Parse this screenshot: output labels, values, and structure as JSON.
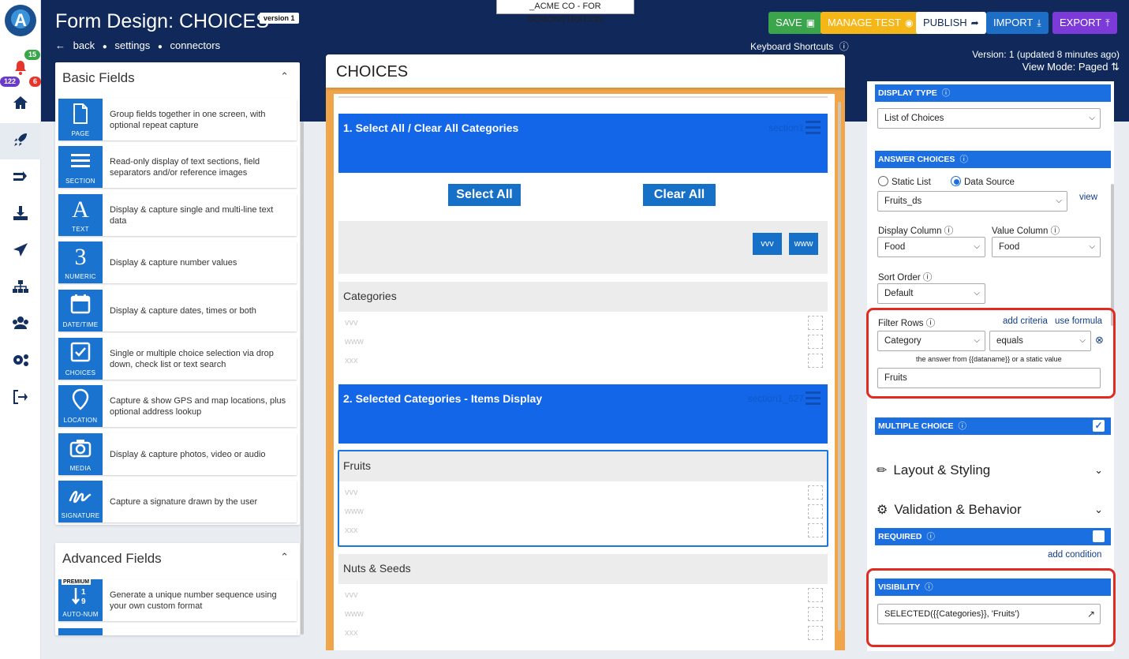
{
  "header": {
    "demo_tag": "_ACME CO - FOR DEMONSTRATION",
    "title": "Form Design: CHOICES",
    "version_badge": "version 1",
    "crumbs": [
      "back",
      "settings",
      "connectors"
    ],
    "keyboard_shortcuts": "Keyboard Shortcuts",
    "version_info": "Version: 1 (updated 8 minutes ago)",
    "view_mode": "View Mode: Paged",
    "buttons": {
      "save": "SAVE",
      "manage_test": "MANAGE TEST",
      "publish": "PUBLISH",
      "import": "IMPORT",
      "export": "EXPORT"
    },
    "button_colors": {
      "save": "#3aa54a",
      "manage_test": "#f5b617",
      "publish": "#ffffff",
      "import": "#1d6ec7",
      "export": "#7c3bd8"
    },
    "header_bg": "#10295a"
  },
  "rail": {
    "badge_green": "15",
    "badge_purple": "122",
    "badge_red": "6",
    "icons": [
      "bell-icon",
      "home-icon",
      "rocket-icon",
      "transfer-icon",
      "download-icon",
      "send-icon",
      "hierarchy-icon",
      "group-icon",
      "settings-icon",
      "logout-icon"
    ]
  },
  "basic_fields": {
    "title": "Basic Fields",
    "items": [
      {
        "label": "PAGE",
        "icon": "page-icon",
        "desc": "Group fields together in one screen, with optional repeat capture"
      },
      {
        "label": "SECTION",
        "icon": "section-icon",
        "desc": "Read-only display of text sections, field separators and/or reference images"
      },
      {
        "label": "TEXT",
        "icon": "text-icon",
        "desc": "Display & capture single and multi-line text data"
      },
      {
        "label": "NUMERIC",
        "icon": "numeric-icon",
        "desc": "Display & capture number values"
      },
      {
        "label": "DATE/TIME",
        "icon": "calendar-icon",
        "desc": "Display & capture dates, times or both"
      },
      {
        "label": "CHOICES",
        "icon": "checkbox-icon",
        "desc": "Single or multiple choice selection via drop down, check list or text search"
      },
      {
        "label": "LOCATION",
        "icon": "location-pin-icon",
        "desc": "Capture & show GPS and map locations, plus optional address lookup"
      },
      {
        "label": "MEDIA",
        "icon": "camera-icon",
        "desc": "Display & capture photos, video or audio"
      },
      {
        "label": "SIGNATURE",
        "icon": "signature-icon",
        "desc": "Capture a signature drawn by the user"
      }
    ]
  },
  "advanced_fields": {
    "title": "Advanced Fields",
    "items": [
      {
        "label": "AUTO-NUM",
        "badge": "PREMIUM",
        "icon": "sort-numeric-icon",
        "desc": "Generate a unique number sequence using your own custom format"
      }
    ]
  },
  "canvas": {
    "title": "CHOICES",
    "section1": {
      "title": "1. Select All / Clear All Categories",
      "id": "section1"
    },
    "select_all": "Select All",
    "clear_all": "Clear All",
    "small_buttons": [
      "vvv",
      "www"
    ],
    "categories": {
      "title": "Categories",
      "options": [
        "vvv",
        "www",
        "xxx"
      ]
    },
    "section2": {
      "title": "2. Selected Categories - Items Display",
      "id": "section1_627"
    },
    "fruits": {
      "title": "Fruits",
      "options": [
        "vvv",
        "www",
        "xxx"
      ]
    },
    "nuts": {
      "title": "Nuts & Seeds",
      "options": [
        "vvv",
        "www",
        "xxx"
      ]
    }
  },
  "props": {
    "display_type_label": "DISPLAY TYPE",
    "display_type_value": "List of Choices",
    "answer_choices_label": "ANSWER CHOICES",
    "static_list": "Static List",
    "data_source": "Data Source",
    "data_source_value": "Fruits_ds",
    "view_link": "view",
    "display_column_label": "Display Column",
    "display_column_value": "Food",
    "value_column_label": "Value Column",
    "value_column_value": "Food",
    "sort_order_label": "Sort Order",
    "sort_order_value": "Default",
    "filter_rows_label": "Filter Rows",
    "add_criteria": "add criteria",
    "use_formula": "use formula",
    "filter_field": "Category",
    "filter_op": "equals",
    "filter_hint": "the answer from {{dataname}} or a static value",
    "filter_value": "Fruits",
    "multiple_choice_label": "MULTIPLE CHOICE",
    "multiple_choice_checked": true,
    "layout_styling": "Layout & Styling",
    "validation_behavior": "Validation & Behavior",
    "required_label": "REQUIRED",
    "add_condition": "add condition",
    "visibility_label": "VISIBILITY",
    "visibility_formula": "SELECTED({{Categories}}, 'Fruits')"
  }
}
